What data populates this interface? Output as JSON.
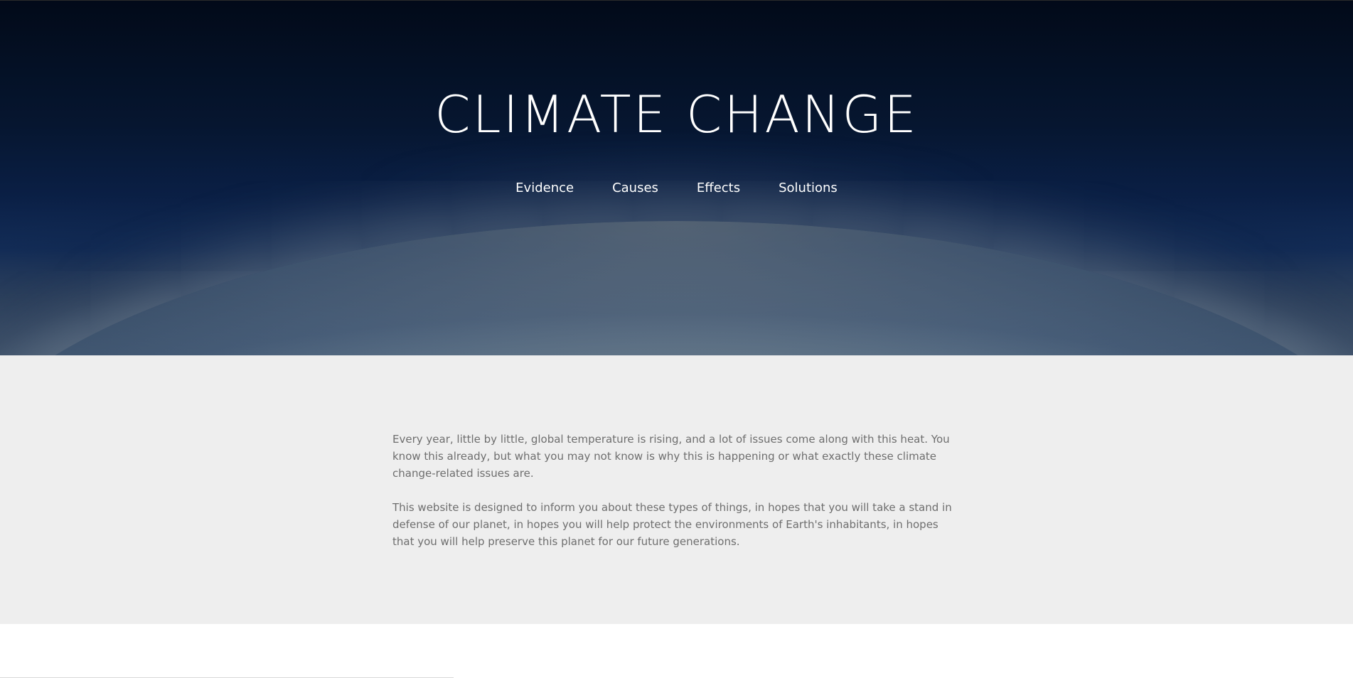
{
  "hero": {
    "title": "CLIMATE CHANGE",
    "nav": [
      {
        "label": "Evidence"
      },
      {
        "label": "Causes"
      },
      {
        "label": "Effects"
      },
      {
        "label": "Solutions"
      }
    ]
  },
  "intro": {
    "paragraphs": [
      "Every year, little by little, global temperature is rising, and a lot of issues come along with this heat. You know this already, but what you may not know is why this is happening or what exactly these climate change-related issues are.",
      "This website is designed to inform you about these types of things, in hopes that you will take a stand in defense of our planet, in hopes you will help protect the environments of Earth's inhabitants, in hopes that you will help preserve this planet for our future generations."
    ]
  }
}
